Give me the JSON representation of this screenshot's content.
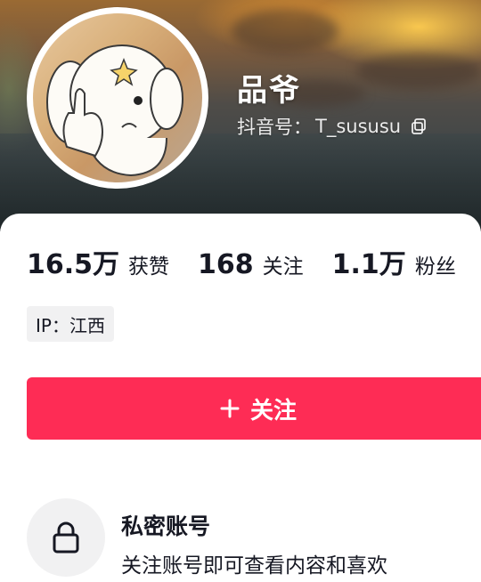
{
  "profile": {
    "name": "品爷",
    "handle_label": "抖音号：",
    "handle": "T_sususu"
  },
  "stats": [
    {
      "value": "16.5万",
      "label": "获赞"
    },
    {
      "value": "168",
      "label": "关注"
    },
    {
      "value": "1.1万",
      "label": "粉丝"
    }
  ],
  "ip": {
    "label": "IP：",
    "location": "江西"
  },
  "follow_button": {
    "label": "关注"
  },
  "private_account": {
    "title": "私密账号",
    "description": "关注账号即可查看内容和喜欢"
  },
  "colors": {
    "accent": "#fe2c55",
    "text": "#161823",
    "chip_bg": "#f1f1f2"
  },
  "icons": [
    "copy-icon",
    "plus-icon",
    "lock-icon"
  ]
}
